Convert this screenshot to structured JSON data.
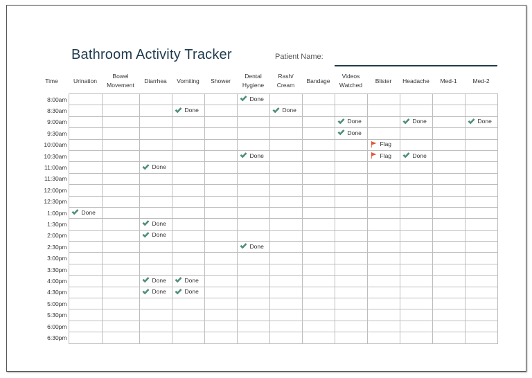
{
  "title": "Bathroom Activity Tracker",
  "patient_label": "Patient Name:",
  "columns": [
    "Time",
    "Urination",
    "Bowel Movement",
    "Diarrhea",
    "Vomiting",
    "Shower",
    "Dental Hygiene",
    "Rash/ Cream",
    "Bandage",
    "Videos Watched",
    "Blister",
    "Headache",
    "Med-1",
    "Med-2"
  ],
  "times": [
    "8:00am",
    "8:30am",
    "9:00am",
    "9:30am",
    "10:00am",
    "10:30am",
    "11:00am",
    "11:30am",
    "12:00pm",
    "12:30pm",
    "1:00pm",
    "1:30pm",
    "2:00pm",
    "2:30pm",
    "3:00pm",
    "3:30pm",
    "4:00pm",
    "4:30pm",
    "5:00pm",
    "5:30pm",
    "6:00pm",
    "6:30pm"
  ],
  "entries": [
    {
      "row": 0,
      "col": 6,
      "type": "check",
      "text": "Done"
    },
    {
      "row": 1,
      "col": 4,
      "type": "check",
      "text": "Done"
    },
    {
      "row": 1,
      "col": 7,
      "type": "check",
      "text": "Done"
    },
    {
      "row": 2,
      "col": 9,
      "type": "check",
      "text": "Done"
    },
    {
      "row": 2,
      "col": 11,
      "type": "check",
      "text": "Done"
    },
    {
      "row": 2,
      "col": 13,
      "type": "check",
      "text": "Done"
    },
    {
      "row": 3,
      "col": 9,
      "type": "check",
      "text": "Done"
    },
    {
      "row": 4,
      "col": 10,
      "type": "flag",
      "text": "Flag"
    },
    {
      "row": 5,
      "col": 6,
      "type": "check",
      "text": "Done"
    },
    {
      "row": 5,
      "col": 10,
      "type": "flag",
      "text": "Flag"
    },
    {
      "row": 5,
      "col": 11,
      "type": "check",
      "text": "Done"
    },
    {
      "row": 6,
      "col": 3,
      "type": "check",
      "text": "Done"
    },
    {
      "row": 10,
      "col": 1,
      "type": "check",
      "text": "Done"
    },
    {
      "row": 11,
      "col": 3,
      "type": "check",
      "text": "Done"
    },
    {
      "row": 12,
      "col": 3,
      "type": "check",
      "text": "Done"
    },
    {
      "row": 13,
      "col": 6,
      "type": "check",
      "text": "Done"
    },
    {
      "row": 16,
      "col": 3,
      "type": "check",
      "text": "Done"
    },
    {
      "row": 16,
      "col": 4,
      "type": "check",
      "text": "Done"
    },
    {
      "row": 17,
      "col": 3,
      "type": "check",
      "text": "Done"
    },
    {
      "row": 17,
      "col": 4,
      "type": "check",
      "text": "Done"
    }
  ],
  "colors": {
    "check": "#4e8d7c",
    "flag": "#e0573a",
    "title": "#1f3b4d"
  },
  "icons": {
    "check": "check-icon",
    "flag": "flag-icon"
  }
}
